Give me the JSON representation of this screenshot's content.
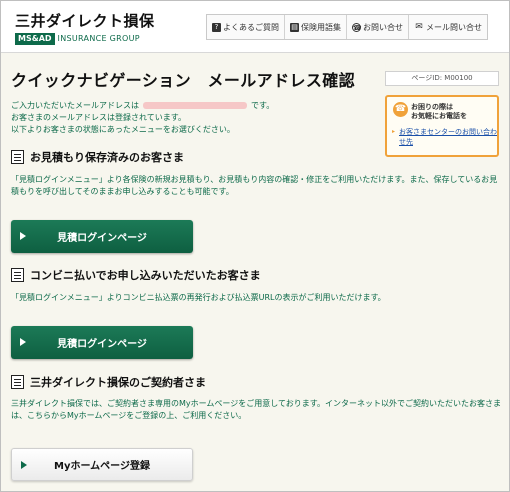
{
  "header": {
    "logo_jp": "三井ダイレクト損保",
    "logo_badge": "MS&AD",
    "logo_group": "INSURANCE GROUP",
    "nav": [
      {
        "label": "よくあるご質問",
        "icon": "question-icon"
      },
      {
        "label": "保険用語集",
        "icon": "book-icon"
      },
      {
        "label": "お問い合せ",
        "icon": "phone-icon"
      },
      {
        "label": "メール問い合せ",
        "icon": "mail-icon"
      }
    ]
  },
  "page": {
    "title": "クイックナビゲーション　メールアドレス確認",
    "page_id": "ページID: M00100"
  },
  "help": {
    "title_line1": "お困りの際は",
    "title_line2": "お気軽にお電話を",
    "link": "お客さまセンターのお問い合わせ先"
  },
  "intro": {
    "line1_prefix": "ご入力いただいたメールアドレスは",
    "line1_suffix": "です。",
    "line2": "お客さまのメールアドレスは登録されています。",
    "line3": "以下よりお客さまの状態にあったメニューをお選びください。"
  },
  "sections": [
    {
      "heading": "お見積もり保存済みのお客さま",
      "body": "「見積ログインメニュー」より各保険の新規お見積もり、お見積もり内容の確認・修正をご利用いただけます。また、保存しているお見積もりを呼び出してそのままお申し込みすることも可能です。",
      "button": "見積ログインページ"
    },
    {
      "heading": "コンビニ払いでお申し込みいただいたお客さま",
      "body": "「見積ログインメニュー」よりコンビニ払込票の再発行および払込票URLの表示がご利用いただけます。",
      "button": "見積ログインページ"
    },
    {
      "heading": "三井ダイレクト損保のご契約者さま",
      "body": "三井ダイレクト損保では、ご契約者さま専用のMyホームページをご用意しております。インターネット以外でご契約いただいたお客さまは、こちらからMyホームページをご登録の上、ご利用ください。",
      "button": "Myホームページ登録"
    }
  ],
  "colors": {
    "brand_green": "#0d6a4a",
    "accent_orange": "#f0a23a",
    "link_blue": "#1a4fa8"
  }
}
